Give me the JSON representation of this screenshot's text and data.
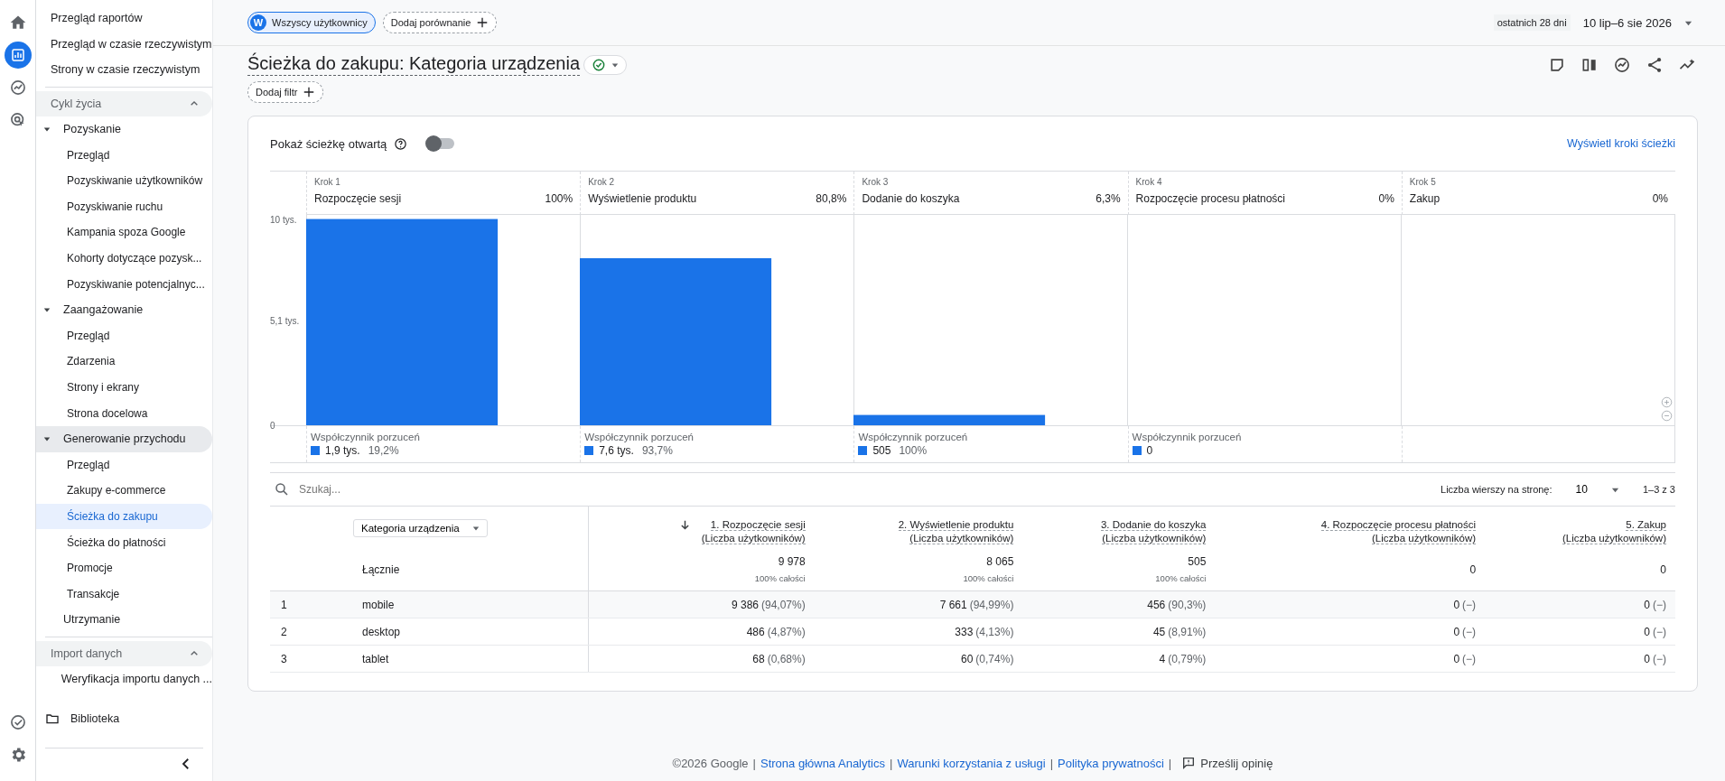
{
  "rail": {
    "top": [
      {
        "kind": "home",
        "selected": false
      },
      {
        "kind": "reports",
        "selected": true
      },
      {
        "kind": "explore",
        "selected": false
      },
      {
        "kind": "advertising",
        "selected": false
      }
    ],
    "bottom": [
      {
        "kind": "check"
      },
      {
        "kind": "settings"
      }
    ]
  },
  "sidebar": {
    "links": [
      "Przegląd raportów",
      "Przegląd w czasie rzeczywistym",
      "Strony w czasie rzeczywistym"
    ],
    "sections": [
      {
        "title": "Cykl życia",
        "expanded": true,
        "items": [
          {
            "label": "Pozyskanie",
            "expanded": true,
            "active": false,
            "children": [
              {
                "label": "Przegląd",
                "selected": false
              },
              {
                "label": "Pozyskiwanie użytkowników",
                "selected": false
              },
              {
                "label": "Pozyskiwanie ruchu",
                "selected": false
              },
              {
                "label": "Kampania spoza Google",
                "selected": false
              },
              {
                "label": "Kohorty dotyczące pozysk...",
                "selected": false
              },
              {
                "label": "Pozyskiwanie potencjalnyc...",
                "selected": false
              }
            ]
          },
          {
            "label": "Zaangażowanie",
            "expanded": true,
            "active": false,
            "children": [
              {
                "label": "Przegląd",
                "selected": false
              },
              {
                "label": "Zdarzenia",
                "selected": false
              },
              {
                "label": "Strony i ekrany",
                "selected": false
              },
              {
                "label": "Strona docelowa",
                "selected": false
              }
            ]
          },
          {
            "label": "Generowanie przychodu",
            "expanded": true,
            "active": true,
            "children": [
              {
                "label": "Przegląd",
                "selected": false
              },
              {
                "label": "Zakupy e-commerce",
                "selected": false
              },
              {
                "label": "Ścieżka do zakupu",
                "selected": true
              },
              {
                "label": "Ścieżka do płatności",
                "selected": false
              },
              {
                "label": "Promocje",
                "selected": false
              },
              {
                "label": "Transakcje",
                "selected": false
              }
            ]
          },
          {
            "label": "Utrzymanie",
            "active": false
          }
        ]
      },
      {
        "title": "Import danych",
        "expanded": true,
        "items": [
          {
            "label": "Weryfikacja importu danych ...",
            "active": false
          }
        ]
      }
    ],
    "library": "Biblioteka"
  },
  "header": {
    "segment": {
      "letter": "W",
      "label": "Wszyscy użytkownicy"
    },
    "compare": "Dodaj porównanie",
    "date_range": {
      "period": "ostatnich 28 dni",
      "dates": "10 lip–6 sie 2026"
    },
    "title": "Ścieżka do zakupu: Kategoria urządzenia",
    "filter": "Dodaj filtr"
  },
  "funnel": {
    "open_path": {
      "label": "Pokaż ścieżkę otwartą",
      "on": false
    },
    "view_steps": "Wyświetl kroki ścieżki",
    "steps": [
      {
        "step": "Krok 1",
        "percent": "100%",
        "abandon": {
          "label": "Współczynnik porzuceń",
          "count": "1,9 tys.",
          "rate": "19,2%"
        }
      },
      {
        "step": "Krok 2",
        "percent": "80,8%",
        "abandon": {
          "label": "Współczynnik porzuceń",
          "count": "7,6 tys.",
          "rate": "93,7%"
        }
      },
      {
        "step": "Krok 3",
        "percent": "6,3%",
        "abandon": {
          "label": "Współczynnik porzuceń",
          "count": "505",
          "rate": "100%"
        }
      },
      {
        "step": "Krok 4",
        "percent": "0%",
        "abandon": {
          "label": "Współczynnik porzuceń",
          "count": "0"
        }
      },
      {
        "step": "Krok 5",
        "percent": "0%"
      }
    ],
    "chart_data": {
      "type": "bar",
      "categories": [
        "Rozpoczęcie sesji",
        "Wyświetlenie produktu",
        "Dodanie do koszyka",
        "Rozpoczęcie procesu płatności",
        "Zakup"
      ],
      "series": [
        {
          "color": "#1a73e8",
          "values": [
            10,
            8.1,
            0.5,
            0,
            0
          ]
        }
      ],
      "ylim": [
        0,
        10.2
      ],
      "yticks": [
        {
          "value": 0,
          "label": "0"
        },
        {
          "value": 5.1,
          "label": "5,1 tys."
        },
        {
          "value": 10,
          "label": "10 tys."
        }
      ]
    }
  },
  "table": {
    "search_placeholder": "Szukaj...",
    "rows_per_page_label": "Liczba wierszy na stronę:",
    "rows_per_page": "10",
    "range": "1–3 z 3",
    "dimension": "Kategoria urządzenia",
    "columns": [
      {
        "title": "1. Rozpoczęcie sesji",
        "subtitle": "(Liczba użytkowników)",
        "sorted": true
      },
      {
        "title": "2. Wyświetlenie produktu",
        "subtitle": "(Liczba użytkowników)",
        "sorted": false
      },
      {
        "title": "3. Dodanie do koszyka",
        "subtitle": "(Liczba użytkowników)",
        "sorted": false
      },
      {
        "title": "4. Rozpoczęcie procesu płatności",
        "subtitle": "(Liczba użytkowników)",
        "sorted": false
      },
      {
        "title": "5. Zakup",
        "subtitle": "(Liczba użytkowników)",
        "sorted": false
      }
    ],
    "totals": {
      "label": "Łącznie",
      "cells": [
        {
          "value": "9 978",
          "share": "100% całości"
        },
        {
          "value": "8 065",
          "share": "100% całości"
        },
        {
          "value": "505",
          "share": "100% całości"
        },
        {
          "value": "0"
        },
        {
          "value": "0"
        }
      ]
    },
    "rows": [
      {
        "index": "1",
        "name": "mobile",
        "cells": [
          {
            "value": "9 386",
            "pct": "(94,07%)"
          },
          {
            "value": "7 661",
            "pct": "(94,99%)"
          },
          {
            "value": "456",
            "pct": "(90,3%)"
          },
          {
            "value": "0",
            "pct": "(−)"
          },
          {
            "value": "0",
            "pct": "(−)"
          }
        ]
      },
      {
        "index": "2",
        "name": "desktop",
        "cells": [
          {
            "value": "486",
            "pct": "(4,87%)"
          },
          {
            "value": "333",
            "pct": "(4,13%)"
          },
          {
            "value": "45",
            "pct": "(8,91%)"
          },
          {
            "value": "0",
            "pct": "(−)"
          },
          {
            "value": "0",
            "pct": "(−)"
          }
        ]
      },
      {
        "index": "3",
        "name": "tablet",
        "cells": [
          {
            "value": "68",
            "pct": "(0,68%)"
          },
          {
            "value": "60",
            "pct": "(0,74%)"
          },
          {
            "value": "4",
            "pct": "(0,79%)"
          },
          {
            "value": "0",
            "pct": "(−)"
          },
          {
            "value": "0",
            "pct": "(−)"
          }
        ]
      }
    ]
  },
  "footer": {
    "separator": "|",
    "items": [
      {
        "kind": "text",
        "label": "©2026 Google"
      },
      {
        "kind": "link",
        "label": "Strona główna Analytics"
      },
      {
        "kind": "link",
        "label": "Warunki korzystania z usługi"
      },
      {
        "kind": "link",
        "label": "Polityka prywatności"
      },
      {
        "kind": "feedback",
        "label": "Prześlij opinię"
      }
    ]
  }
}
